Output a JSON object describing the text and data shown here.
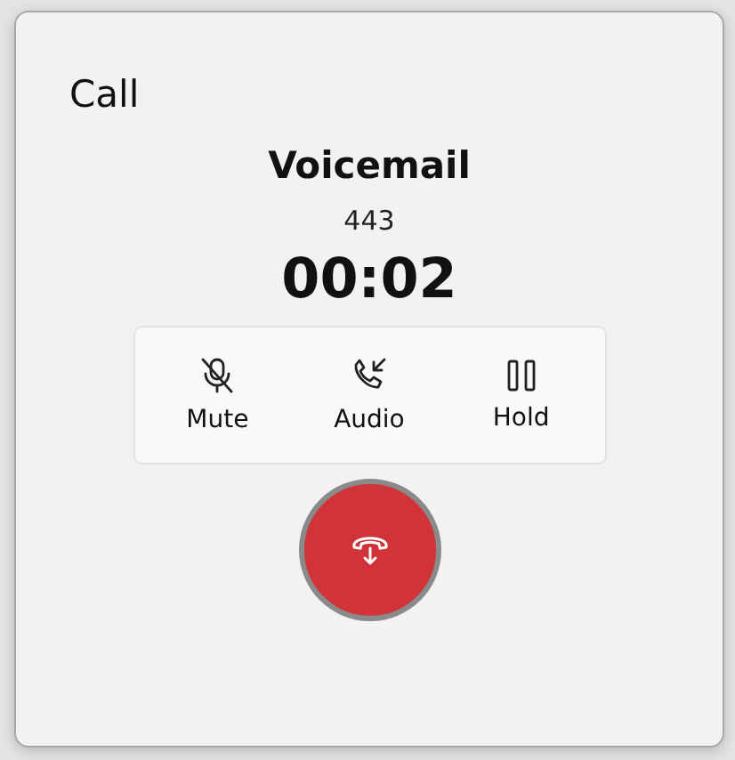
{
  "dialog": {
    "title": "Call"
  },
  "contact": {
    "name": "Voicemail",
    "number": "443",
    "duration": "00:02"
  },
  "controls": [
    {
      "label": "Mute",
      "kind": "mute"
    },
    {
      "label": "Audio",
      "kind": "audio"
    },
    {
      "label": "Hold",
      "kind": "hold"
    }
  ],
  "end_call": {
    "kind": "hangup"
  }
}
